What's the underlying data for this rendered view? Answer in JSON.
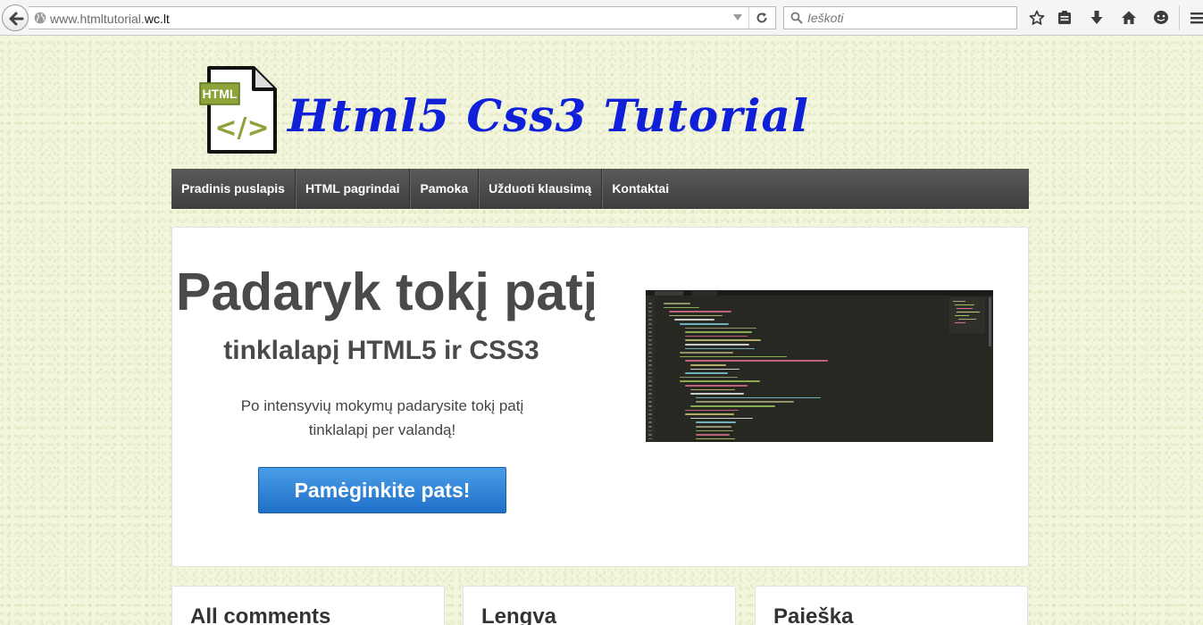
{
  "browser": {
    "url_prefix": "www.htmltutorial.",
    "url_domain": "wc.lt",
    "search_placeholder": "Ieškoti"
  },
  "site": {
    "title": "Html5 Css3 Tutorial",
    "logo_badge": "HTML",
    "logo_symbol": "</>"
  },
  "nav": {
    "items": [
      {
        "label": "Pradinis puslapis"
      },
      {
        "label": "HTML pagrindai"
      },
      {
        "label": "Pamoka"
      },
      {
        "label": "Užduoti klausimą"
      },
      {
        "label": "Kontaktai"
      }
    ]
  },
  "hero": {
    "title": "Padaryk tokį patį",
    "subtitle": "tinklalapį HTML5 ir CSS3",
    "text": "Po intensyvių mokymų padarysite tokį patį tinklalapį per valandą!",
    "button": "Pamėginkite pats!"
  },
  "cards": [
    {
      "title": "All comments"
    },
    {
      "title": "Lengva"
    },
    {
      "title": "Paieška"
    }
  ],
  "colors": {
    "title": "#1020d8",
    "nav_bg": "#4a4a4a",
    "button": "#2b7fd6",
    "logo_green": "#8ea43a"
  }
}
